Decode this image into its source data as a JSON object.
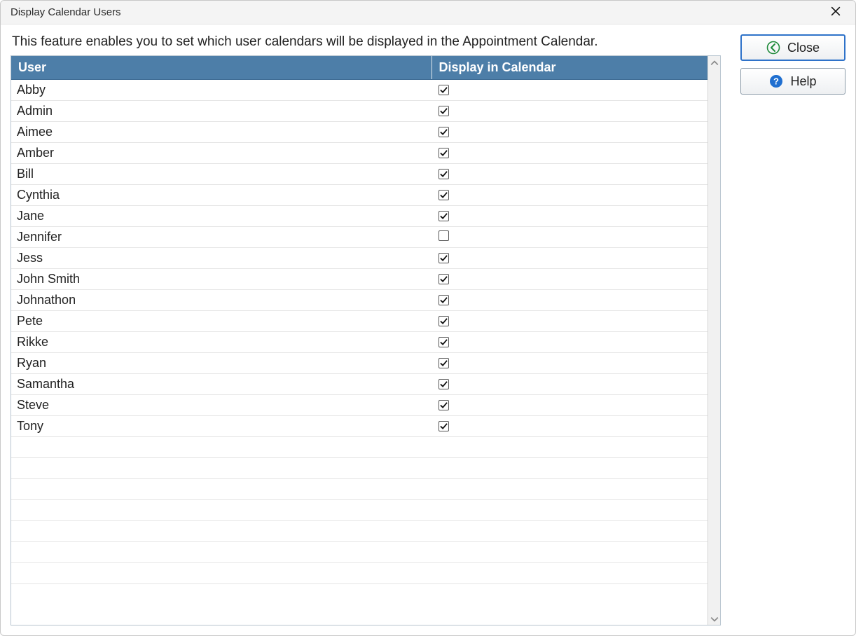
{
  "window": {
    "title": "Display Calendar Users"
  },
  "description": "This feature enables you to set which user calendars will be displayed in the Appointment Calendar.",
  "table": {
    "headers": {
      "user": "User",
      "display": "Display in Calendar"
    },
    "rows": [
      {
        "name": "Abby",
        "display": true
      },
      {
        "name": "Admin",
        "display": true
      },
      {
        "name": "Aimee",
        "display": true
      },
      {
        "name": "Amber",
        "display": true
      },
      {
        "name": "Bill",
        "display": true
      },
      {
        "name": "Cynthia",
        "display": true
      },
      {
        "name": "Jane",
        "display": true
      },
      {
        "name": "Jennifer",
        "display": false
      },
      {
        "name": "Jess",
        "display": true
      },
      {
        "name": "John Smith",
        "display": true
      },
      {
        "name": "Johnathon",
        "display": true
      },
      {
        "name": "Pete",
        "display": true
      },
      {
        "name": "Rikke",
        "display": true
      },
      {
        "name": "Ryan",
        "display": true
      },
      {
        "name": "Samantha",
        "display": true
      },
      {
        "name": "Steve",
        "display": true
      },
      {
        "name": "Tony",
        "display": true
      }
    ],
    "empty_rows": 7
  },
  "buttons": {
    "close": "Close",
    "help": "Help"
  }
}
